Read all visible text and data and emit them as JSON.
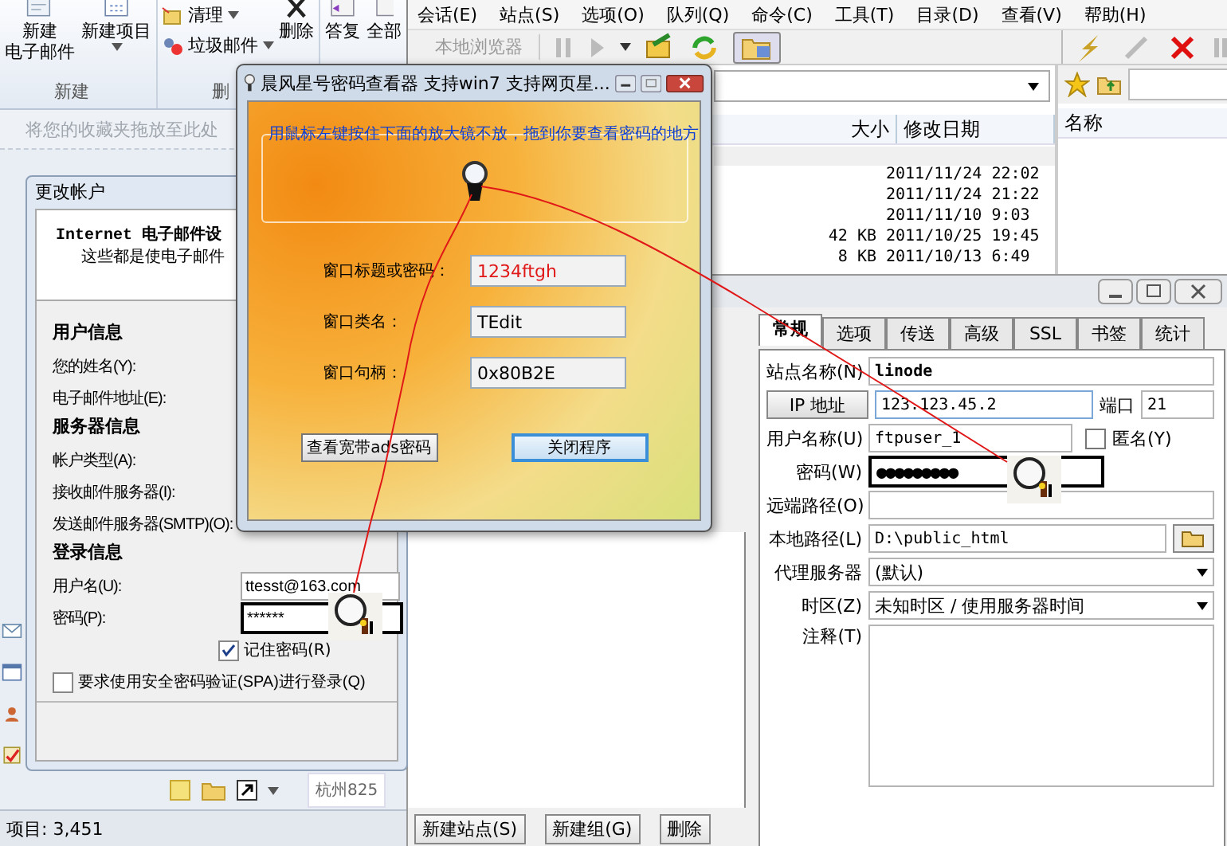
{
  "outlook": {
    "ribbon": {
      "new_email": [
        "新建",
        "电子邮件"
      ],
      "new_item": "新建项目",
      "clean_up": "清理",
      "junk": "垃圾邮件",
      "delete": "删除",
      "reply": "答复",
      "reply_all": "全部",
      "group_new": "新建",
      "group_delete": "删"
    },
    "favorites_hint": "将您的收藏夹拖放至此处",
    "preview_item": "杭州825",
    "status_bar": "项目: 3,451"
  },
  "ftp": {
    "menu": [
      "会话(E)",
      "站点(S)",
      "选项(O)",
      "队列(Q)",
      "命令(C)",
      "工具(T)",
      "目录(D)",
      "查看(V)",
      "帮助(H)"
    ],
    "local_browser": "本地浏览器",
    "columns": {
      "size": "大小",
      "modified": "修改日期",
      "name": "名称"
    },
    "rows": [
      {
        "modified": "2011/11/24 22:02"
      },
      {
        "modified": "2011/11/24 21:22"
      },
      {
        "modified": "2011/11/10 9:03"
      },
      {
        "size": "42 KB",
        "modified": "2011/10/25 19:45"
      },
      {
        "size": "8 KB",
        "modified": "2011/10/13 6:49"
      }
    ]
  },
  "site_manager": {
    "tabs": [
      {
        "label": "常规",
        "selected": true
      },
      {
        "label": "选项",
        "selected": false
      },
      {
        "label": "传送",
        "selected": false
      },
      {
        "label": "高级",
        "selected": false
      },
      {
        "label": "SSL",
        "selected": false
      },
      {
        "label": "书签",
        "selected": false
      },
      {
        "label": "统计",
        "selected": false
      }
    ],
    "fields": [
      {
        "kind": "text",
        "label": "站点名称(N)",
        "value": "linode"
      },
      {
        "kind": "address",
        "label": "IP 地址",
        "value": "123.123.45.2",
        "port_label": "端口",
        "port": "21"
      },
      {
        "kind": "user",
        "label": "用户名称(U)",
        "value": "ftpuser_1",
        "anonymous": {
          "label": "匿名(Y)",
          "checked": false
        }
      },
      {
        "kind": "password",
        "label": "密码(W)",
        "value": "●●●●●●●●●"
      },
      {
        "kind": "text",
        "label": "远端路径(O)"
      },
      {
        "kind": "browse",
        "label": "本地路径(L)",
        "value": "D:\\public_html"
      },
      {
        "kind": "select",
        "label": "代理服务器",
        "value": "(默认)"
      },
      {
        "kind": "select",
        "label": "时区(Z)",
        "value": "未知时区 / 使用服务器时间"
      },
      {
        "kind": "notes",
        "label": "注释(T)"
      }
    ],
    "buttons": [
      "新建站点(S)",
      "新建组(G)",
      "删除"
    ]
  },
  "account": {
    "title": "更改帐户",
    "heading": "Internet 电子邮件设",
    "subheading": "这些都是使电子邮件",
    "sections": [
      {
        "title": "用户信息",
        "fields": [
          {
            "label": "您的姓名(Y):"
          },
          {
            "label": "电子邮件地址(E):"
          }
        ]
      },
      {
        "title": "服务器信息",
        "fields": [
          {
            "label": "帐户类型(A):"
          },
          {
            "label": "接收邮件服务器(I):"
          },
          {
            "label": "发送邮件服务器(SMTP)(O):"
          }
        ]
      },
      {
        "title": "登录信息",
        "fields": [
          {
            "label": "用户名(U):",
            "value": "ttesst@163.com"
          },
          {
            "label": "密码(P):",
            "value": "******",
            "highlighted": true
          }
        ]
      }
    ],
    "remember_password": {
      "label": "记住密码(R)",
      "checked": true
    },
    "spa": {
      "label": "要求使用安全密码验证(SPA)进行登录(Q)",
      "checked": false
    }
  },
  "viewer": {
    "title": "晨风星号密码查看器 支持win7 支持网页星...",
    "instruction": "用鼠标左键按住下面的放大镜不放，拖到你要查看密码的地方",
    "fields": [
      {
        "label": "窗口标题或密码：",
        "value": "1234ftgh",
        "kind": "secret"
      },
      {
        "label": "窗口类名：",
        "value": "TEdit",
        "kind": "plain"
      },
      {
        "label": "窗口句柄：",
        "value": "0x80B2E",
        "kind": "plain"
      }
    ],
    "buttons": [
      {
        "label": "查看宽带ads密码",
        "default": false
      },
      {
        "label": "关闭程序",
        "default": true
      }
    ]
  }
}
